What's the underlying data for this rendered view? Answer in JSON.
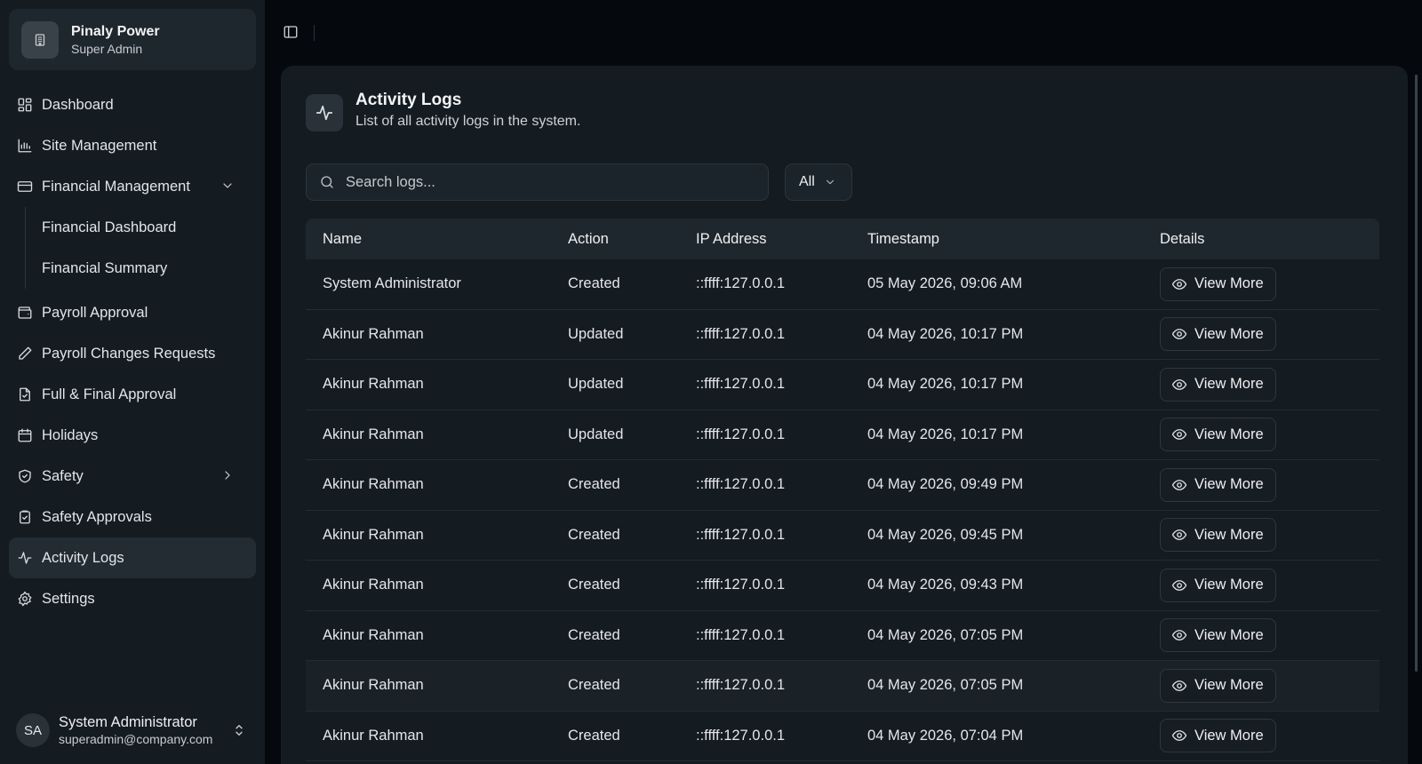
{
  "brand": {
    "name": "Pinaly Power",
    "role": "Super Admin"
  },
  "sidebar": {
    "items": [
      {
        "label": "Dashboard",
        "icon": "dashboard-icon"
      },
      {
        "label": "Site Management",
        "icon": "chart-icon"
      },
      {
        "label": "Financial Management",
        "icon": "credit-card-icon",
        "expanded": true,
        "children": [
          {
            "label": "Financial Dashboard"
          },
          {
            "label": "Financial Summary"
          }
        ]
      },
      {
        "label": "Payroll Approval",
        "icon": "wallet-icon"
      },
      {
        "label": "Payroll Changes Requests",
        "icon": "pencil-icon"
      },
      {
        "label": "Full & Final Approval",
        "icon": "file-icon"
      },
      {
        "label": "Holidays",
        "icon": "calendar-icon"
      },
      {
        "label": "Safety",
        "icon": "shield-icon"
      },
      {
        "label": "Safety Approvals",
        "icon": "clipboard-check-icon"
      },
      {
        "label": "Activity Logs",
        "icon": "activity-icon",
        "active": true
      },
      {
        "label": "Settings",
        "icon": "gear-icon"
      }
    ]
  },
  "user": {
    "initials": "SA",
    "name": "System Administrator",
    "email": "superadmin@company.com"
  },
  "header": {
    "title": "Activity Logs",
    "subtitle": "List of all activity logs in the system."
  },
  "search": {
    "placeholder": "Search logs..."
  },
  "filter": {
    "value": "All"
  },
  "table": {
    "columns": [
      "Name",
      "Action",
      "IP Address",
      "Timestamp",
      "Details"
    ],
    "button_label": "View More",
    "rows": [
      {
        "name": "System Administrator",
        "action": "Created",
        "ip": "::ffff:127.0.0.1",
        "timestamp": "05 May 2026, 09:06 AM"
      },
      {
        "name": "Akinur Rahman",
        "action": "Updated",
        "ip": "::ffff:127.0.0.1",
        "timestamp": "04 May 2026, 10:17 PM"
      },
      {
        "name": "Akinur Rahman",
        "action": "Updated",
        "ip": "::ffff:127.0.0.1",
        "timestamp": "04 May 2026, 10:17 PM"
      },
      {
        "name": "Akinur Rahman",
        "action": "Updated",
        "ip": "::ffff:127.0.0.1",
        "timestamp": "04 May 2026, 10:17 PM"
      },
      {
        "name": "Akinur Rahman",
        "action": "Created",
        "ip": "::ffff:127.0.0.1",
        "timestamp": "04 May 2026, 09:49 PM"
      },
      {
        "name": "Akinur Rahman",
        "action": "Created",
        "ip": "::ffff:127.0.0.1",
        "timestamp": "04 May 2026, 09:45 PM"
      },
      {
        "name": "Akinur Rahman",
        "action": "Created",
        "ip": "::ffff:127.0.0.1",
        "timestamp": "04 May 2026, 09:43 PM"
      },
      {
        "name": "Akinur Rahman",
        "action": "Created",
        "ip": "::ffff:127.0.0.1",
        "timestamp": "04 May 2026, 07:05 PM"
      },
      {
        "name": "Akinur Rahman",
        "action": "Created",
        "ip": "::ffff:127.0.0.1",
        "timestamp": "04 May 2026, 07:05 PM",
        "hover": true
      },
      {
        "name": "Akinur Rahman",
        "action": "Created",
        "ip": "::ffff:127.0.0.1",
        "timestamp": "04 May 2026, 07:04 PM"
      }
    ]
  }
}
